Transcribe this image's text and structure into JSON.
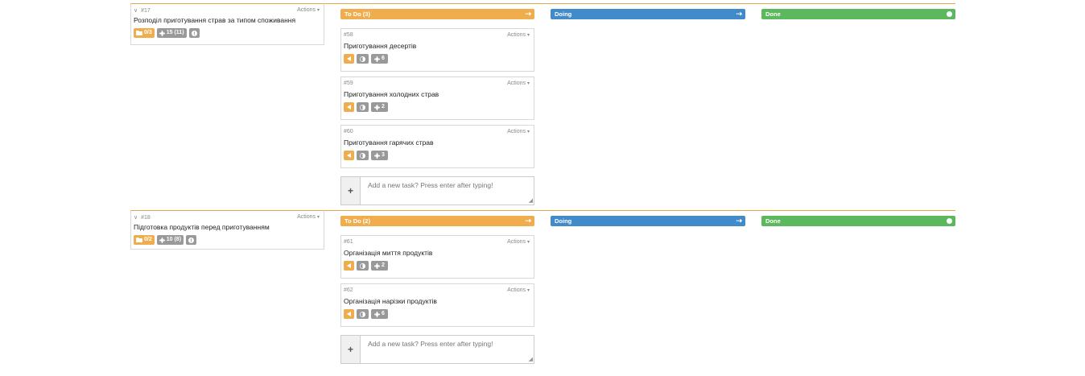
{
  "common": {
    "actions_label": "Actions",
    "add_task_placeholder": "Add a new task? Press enter after typing!",
    "add_button_label": "+",
    "arrow_symbol": "⇢",
    "caret_symbol": "▾",
    "chevron_symbol": "∨"
  },
  "colors": {
    "todo": "#efad4d",
    "doing": "#428bca",
    "done": "#5cb85c",
    "badge_gray": "#999999"
  },
  "rows": [
    {
      "story": {
        "id": "#17",
        "title": "Розподіл приготування страв за типом споживання",
        "badge_tasks": "0/3",
        "badge_points": "15 (11)",
        "badge_info_icon": "info-icon"
      },
      "columns": {
        "todo": "To Do (3)",
        "doing": "Doing",
        "done": "Done"
      },
      "tasks": [
        {
          "id": "#58",
          "title": "Приготування десертів",
          "points": "6"
        },
        {
          "id": "#59",
          "title": "Приготування холодних страв",
          "points": "2"
        },
        {
          "id": "#60",
          "title": "Приготування гарячих страв",
          "points": "3"
        }
      ]
    },
    {
      "story": {
        "id": "#18",
        "title": "Підготовка продуктів перед приготуванням",
        "badge_tasks": "0/2",
        "badge_points": "10 (8)",
        "badge_info_icon": "info-icon"
      },
      "columns": {
        "todo": "To Do (2)",
        "doing": "Doing",
        "done": "Done"
      },
      "tasks": [
        {
          "id": "#61",
          "title": "Організація миття продуктів",
          "points": "2"
        },
        {
          "id": "#62",
          "title": "Організація нарізки продуктів",
          "points": "6"
        }
      ]
    }
  ]
}
